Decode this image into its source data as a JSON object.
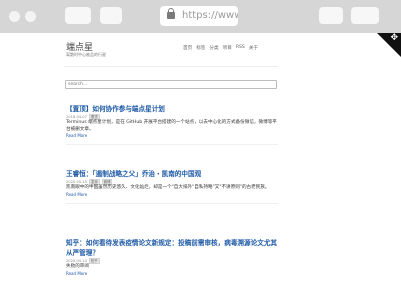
{
  "browser": {
    "url": "https://www."
  },
  "site": {
    "title": "端点星",
    "subtitle": "离散时中心被品的行星",
    "nav": [
      "首页",
      "标签",
      "分类",
      "项目",
      "RSS",
      "关于"
    ],
    "search_placeholder": "search..."
  },
  "posts": [
    {
      "title": "【置顶】如何协作参与端点星计划",
      "date": "2018-04-07",
      "tags": [
        "置顶"
      ],
      "excerpt": "Terminus 端点星计划，是在 GitHub 开展平台搭建的一个站点，以去中心化的方式备份微信，微博等平台被删文章。",
      "more": "Read More"
    },
    {
      "title": "王睿恒：「遏制战略之父」乔治・凯南的中国观",
      "date": "2020-05-15",
      "tags": [
        "澎湃",
        "微博"
      ],
      "excerpt": "凯南眼中的中国虽然历史悠久、文化灿烂，却是一个\"自大排外\"自私持略\"又\"不讲原则\"的古老民族。",
      "more": "Read More"
    },
    {
      "title": "知乎：如何看待发表疫情论文新规定：投稿前需审核，病毒溯源论文尤其从严管理？",
      "date": "2020-04-14",
      "tags": [
        "知乎"
      ],
      "excerpt": "失败的审阅",
      "more": "Read More"
    }
  ]
}
